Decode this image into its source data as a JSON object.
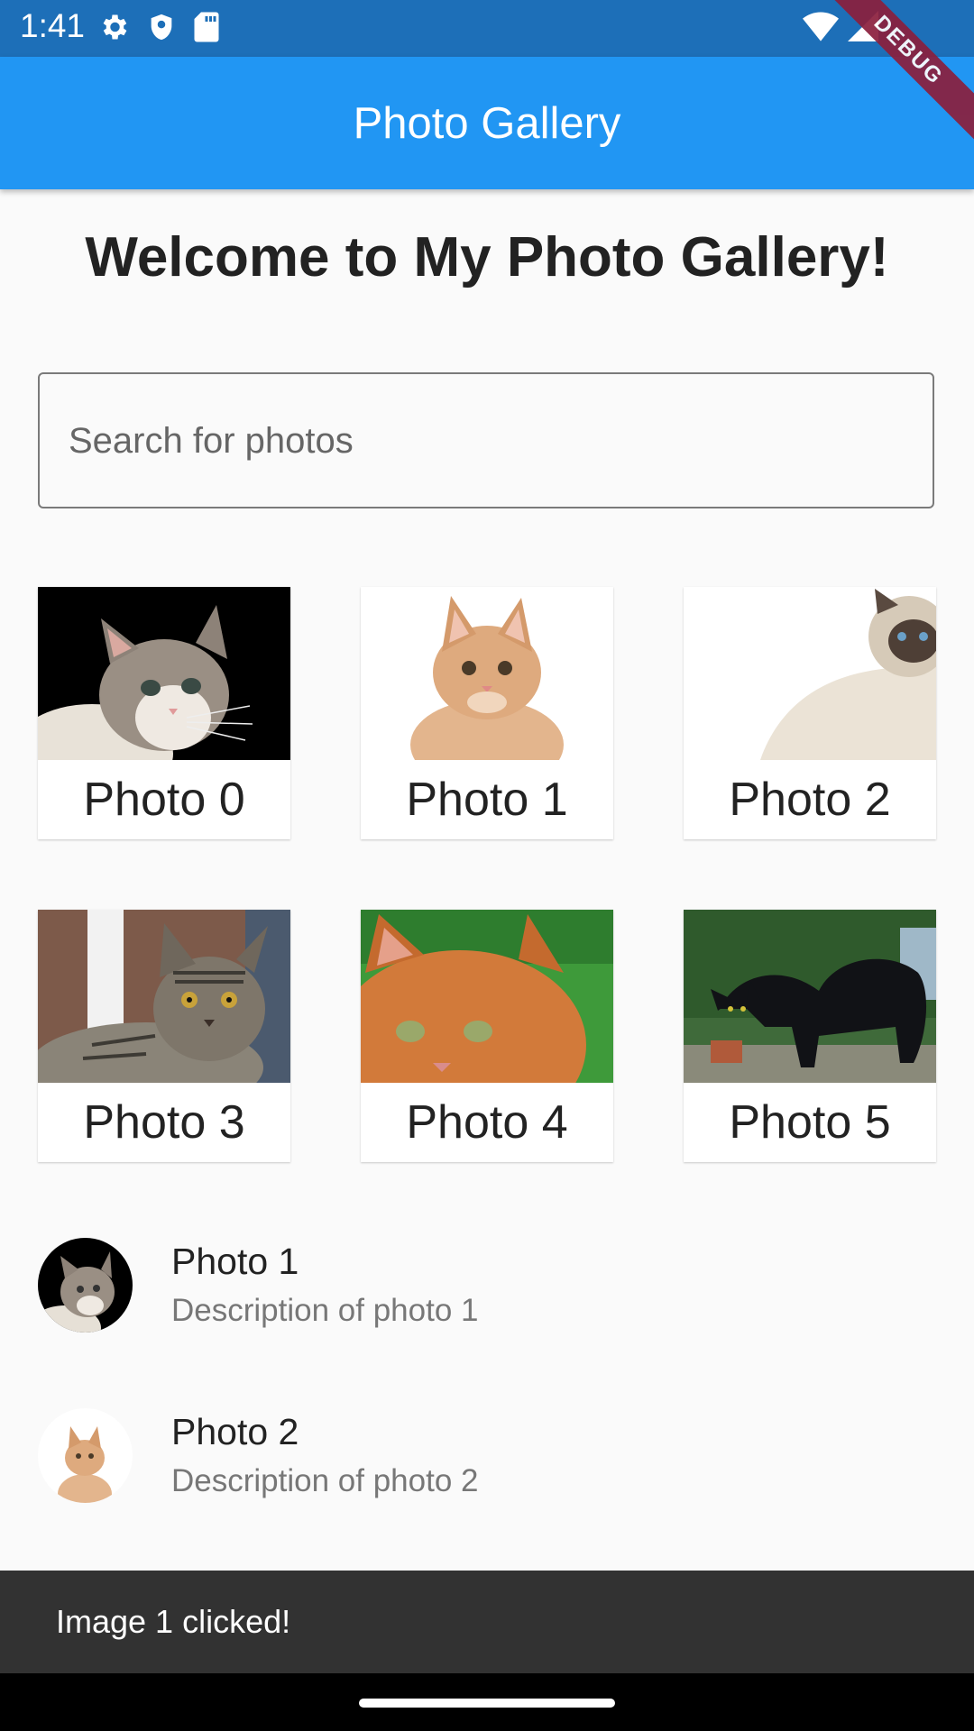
{
  "status_bar": {
    "time": "1:41",
    "left_icons": [
      "gear-icon",
      "shield-icon",
      "sd-card-icon"
    ],
    "right_icons": [
      "wifi-icon",
      "signal-icon"
    ]
  },
  "debug_banner": "DEBUG",
  "app_bar": {
    "title": "Photo Gallery",
    "color": "#2196f3"
  },
  "welcome": "Welcome to My Photo Gallery!",
  "search": {
    "placeholder": "Search for photos",
    "value": ""
  },
  "grid": [
    {
      "label": "Photo 0",
      "image": "cat-photo"
    },
    {
      "label": "Photo 1",
      "image": "kitten-photo"
    },
    {
      "label": "Photo 2",
      "image": "himalayan-cat-photo"
    },
    {
      "label": "Photo 3",
      "image": "tabby-cat-photo"
    },
    {
      "label": "Photo 4",
      "image": "orange-cat-photo"
    },
    {
      "label": "Photo 5",
      "image": "black-cat-photo"
    }
  ],
  "list": [
    {
      "title": "Photo 1",
      "subtitle": "Description of photo 1"
    },
    {
      "title": "Photo 2",
      "subtitle": "Description of photo 2"
    }
  ],
  "snackbar": {
    "message": "Image 1 clicked!"
  }
}
